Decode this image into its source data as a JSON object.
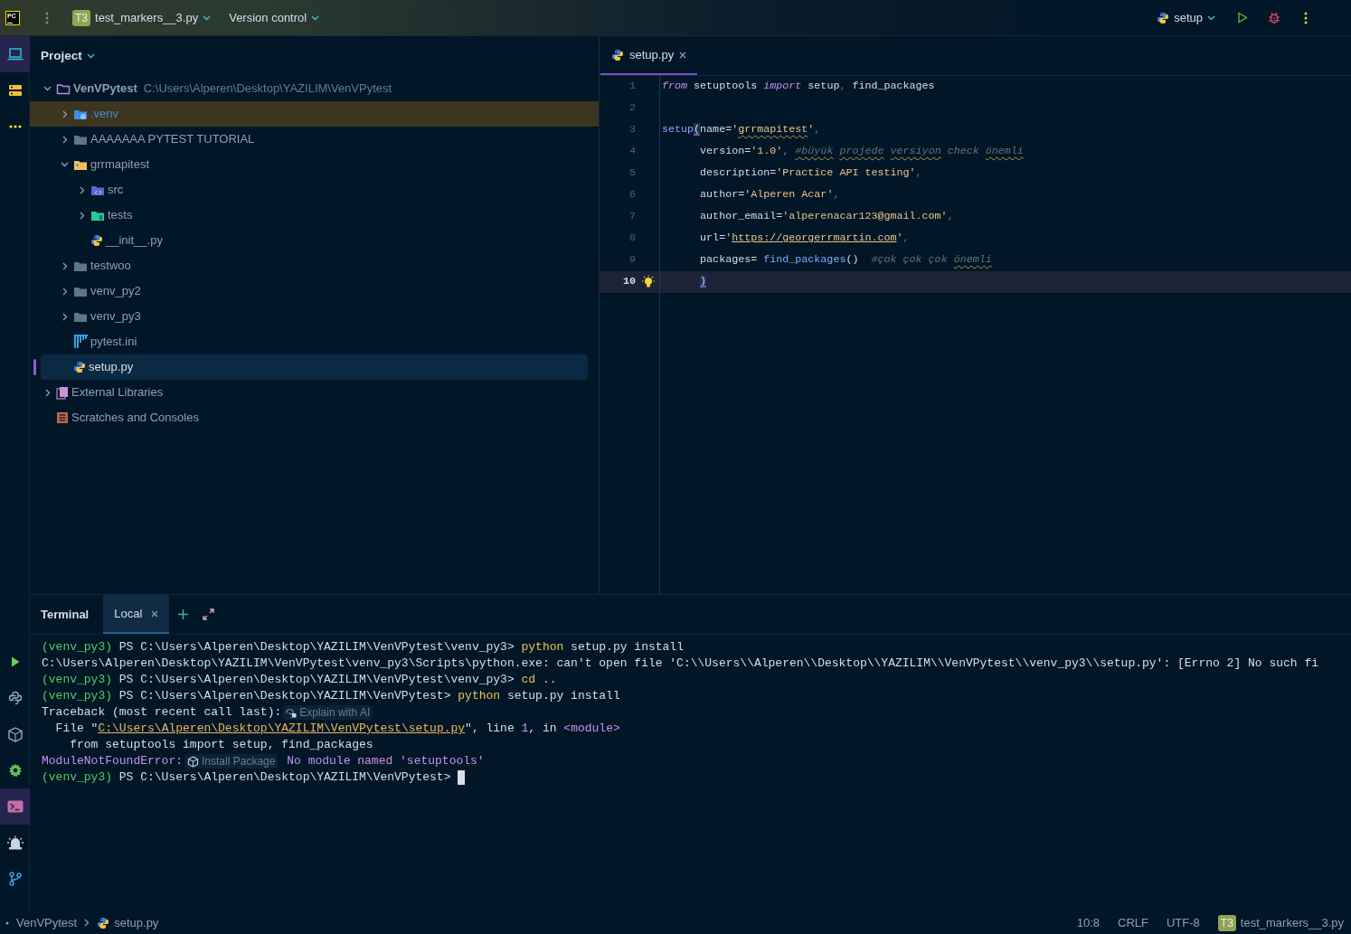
{
  "titlebar": {
    "app_logo": "PC",
    "project_badge": "T3",
    "project": "test_markers__3.py",
    "vcs": "Version control",
    "run_config": "setup"
  },
  "left_toolbar": {
    "top": [
      {
        "kind": "project",
        "selected": true
      },
      {
        "kind": "structure",
        "selected": false
      },
      {
        "kind": "more",
        "selected": false
      }
    ],
    "bottom": [
      {
        "kind": "run",
        "selected": false
      },
      {
        "kind": "python_console",
        "selected": false
      },
      {
        "kind": "python_packages",
        "selected": false
      },
      {
        "kind": "services",
        "selected": false
      },
      {
        "kind": "terminal",
        "selected": true
      },
      {
        "kind": "problems",
        "selected": false
      },
      {
        "kind": "git",
        "selected": false
      }
    ]
  },
  "project": {
    "title": "Project",
    "tree": [
      {
        "name": "VenVPytest",
        "path": "C:\\Users\\Alperen\\Desktop\\YAZILIM\\VenVPytest",
        "kind": "root",
        "expanded": true,
        "selected": false,
        "excluded": false,
        "children": [
          {
            "name": ".venv",
            "kind": "venv",
            "expanded": false,
            "selected": false,
            "excluded": true
          },
          {
            "name": "AAAAAAA PYTEST TUTORIAL",
            "kind": "folder",
            "expanded": false,
            "selected": false,
            "excluded": false
          },
          {
            "name": "grrmapitest",
            "kind": "package",
            "expanded": true,
            "selected": false,
            "excluded": false,
            "children": [
              {
                "name": "src",
                "kind": "source",
                "expanded": false,
                "selected": false,
                "excluded": false
              },
              {
                "name": "tests",
                "kind": "tests",
                "expanded": false,
                "selected": false,
                "excluded": false
              },
              {
                "name": "__init__.py",
                "kind": "python",
                "selected": false,
                "excluded": false
              }
            ]
          },
          {
            "name": "testwoo",
            "kind": "folder",
            "expanded": false,
            "selected": false,
            "excluded": false
          },
          {
            "name": "venv_py2",
            "kind": "folder",
            "expanded": false,
            "selected": false,
            "excluded": false
          },
          {
            "name": "venv_py3",
            "kind": "folder",
            "expanded": false,
            "selected": false,
            "excluded": false
          },
          {
            "name": "pytest.ini",
            "kind": "ini",
            "selected": false,
            "excluded": false
          },
          {
            "name": "setup.py",
            "kind": "python",
            "selected": true,
            "excluded": false
          }
        ]
      },
      {
        "name": "External Libraries",
        "kind": "library",
        "expanded": false,
        "selected": false,
        "excluded": false
      },
      {
        "name": "Scratches and Consoles",
        "kind": "scratches",
        "selected": false,
        "excluded": false
      }
    ]
  },
  "editor": {
    "tabs": [
      {
        "label": "setup.py",
        "selected": true
      }
    ],
    "lines": [
      {
        "number": "1",
        "current": false,
        "segments": [
          {
            "kind": "keyword",
            "text": "from"
          },
          {
            "kind": "plain",
            "text": " setuptools "
          },
          {
            "kind": "keyword",
            "text": "import"
          },
          {
            "kind": "plain",
            "text": " setup"
          },
          {
            "kind": "punct",
            "text": ","
          },
          {
            "kind": "plain",
            "text": " find_packages"
          }
        ]
      },
      {
        "number": "2",
        "current": false
      },
      {
        "number": "3",
        "current": false,
        "segments": [
          {
            "kind": "function",
            "text": "setup"
          },
          {
            "kind": "brace",
            "text": "("
          },
          {
            "kind": "plain",
            "text": "name="
          },
          {
            "kind": "string",
            "text": "'"
          },
          {
            "kind": "string",
            "text": "grrmapitest",
            "typo": true
          },
          {
            "kind": "string",
            "text": "'"
          },
          {
            "kind": "punct",
            "text": ","
          }
        ]
      },
      {
        "number": "4",
        "current": false,
        "segments": [
          {
            "kind": "plain",
            "text": "      version="
          },
          {
            "kind": "string",
            "text": "'1.0'"
          },
          {
            "kind": "punct",
            "text": ", "
          },
          {
            "kind": "comment",
            "text": "#büyük",
            "typo": true
          },
          {
            "kind": "comment",
            "text": " projede",
            "typo": true
          },
          {
            "kind": "comment",
            "text": " versiyon",
            "typo": true
          },
          {
            "kind": "comment",
            "text": " check "
          },
          {
            "kind": "comment",
            "text": "önemli",
            "typo": true
          }
        ]
      },
      {
        "number": "5",
        "current": false,
        "segments": [
          {
            "kind": "plain",
            "text": "      description="
          },
          {
            "kind": "string",
            "text": "'Practice API testing'"
          },
          {
            "kind": "punct",
            "text": ","
          }
        ]
      },
      {
        "number": "6",
        "current": false,
        "segments": [
          {
            "kind": "plain",
            "text": "      author="
          },
          {
            "kind": "string",
            "text": "'Alperen Acar'"
          },
          {
            "kind": "punct",
            "text": ","
          }
        ]
      },
      {
        "number": "7",
        "current": false,
        "segments": [
          {
            "kind": "plain",
            "text": "      author_email="
          },
          {
            "kind": "string",
            "text": "'alperenacar123@gmail.com'"
          },
          {
            "kind": "punct",
            "text": ","
          }
        ]
      },
      {
        "number": "8",
        "current": false,
        "segments": [
          {
            "kind": "plain",
            "text": "      url="
          },
          {
            "kind": "string",
            "text": "'"
          },
          {
            "kind": "url",
            "text": "https://georgerrmartin.com"
          },
          {
            "kind": "string",
            "text": "'"
          },
          {
            "kind": "punct",
            "text": ","
          }
        ]
      },
      {
        "number": "9",
        "current": false,
        "segments": [
          {
            "kind": "plain",
            "text": "      packages= "
          },
          {
            "kind": "function",
            "text": "find_packages"
          },
          {
            "kind": "plain",
            "text": "()"
          },
          {
            "kind": "comment",
            "text": "  #çok çok çok "
          },
          {
            "kind": "comment",
            "text": "önemli",
            "typo": true
          }
        ]
      },
      {
        "number": "10",
        "current": true,
        "intention_bulb": true,
        "segments": [
          {
            "kind": "brace",
            "text": "      )"
          }
        ]
      }
    ]
  },
  "terminal": {
    "title": "Terminal",
    "tabs": [
      {
        "label": "Local",
        "selected": true
      }
    ],
    "lines": [
      [
        {
          "kind": "env",
          "text": "(venv_py3)"
        },
        {
          "kind": "plain",
          "text": " PS C:\\Users\\Alperen\\Desktop\\YAZILIM\\VenVPytest\\venv_py3> "
        },
        {
          "kind": "command",
          "text": "python"
        },
        {
          "kind": "plain",
          "text": " setup.py install"
        }
      ],
      [
        {
          "kind": "plain",
          "text": "C:\\Users\\Alperen\\Desktop\\YAZILIM\\VenVPytest\\venv_py3\\Scripts\\python.exe: can't open file 'C:\\\\Users\\\\Alperen\\\\Desktop\\\\YAZILIM\\\\VenVPytest\\\\venv_py3\\\\setup.py': [Errno 2] No such fi"
        }
      ],
      [
        {
          "kind": "env",
          "text": "(venv_py3)"
        },
        {
          "kind": "plain",
          "text": " PS C:\\Users\\Alperen\\Desktop\\YAZILIM\\VenVPytest\\venv_py3> "
        },
        {
          "kind": "command",
          "text": "cd .."
        }
      ],
      [
        {
          "kind": "env",
          "text": "(venv_py3)"
        },
        {
          "kind": "plain",
          "text": " PS C:\\Users\\Alperen\\Desktop\\YAZILIM\\VenVPytest> "
        },
        {
          "kind": "command",
          "text": "python"
        },
        {
          "kind": "plain",
          "text": " setup.py install"
        }
      ],
      [
        {
          "kind": "plain",
          "text": "Traceback (most recent call last):"
        },
        {
          "kind": "ai_hint",
          "text": "Explain with AI"
        }
      ],
      [
        {
          "kind": "plain",
          "text": "  File \""
        },
        {
          "kind": "link",
          "text": "C:\\Users\\Alperen\\Desktop\\YAZILIM\\VenVPytest\\setup.py"
        },
        {
          "kind": "plain",
          "text": "\", line "
        },
        {
          "kind": "number",
          "text": "1"
        },
        {
          "kind": "plain",
          "text": ", in "
        },
        {
          "kind": "number",
          "text": "<module>"
        }
      ],
      [
        {
          "kind": "plain",
          "text": "    from setuptools import setup, find_packages"
        }
      ],
      [
        {
          "kind": "error",
          "text": "ModuleNotFoundError:"
        },
        {
          "kind": "package_hint",
          "text": "Install Package"
        },
        {
          "kind": "error",
          "text": " No module named 'setuptools'"
        }
      ],
      [
        {
          "kind": "env",
          "text": "(venv_py3)"
        },
        {
          "kind": "plain",
          "text": " PS C:\\Users\\Alperen\\Desktop\\YAZILIM\\VenVPytest> "
        },
        {
          "kind": "cursor"
        }
      ]
    ]
  },
  "status_bar": {
    "breadcrumbs": [
      {
        "kind": "project",
        "label": "VenVPytest"
      },
      {
        "kind": "python",
        "label": "setup.py"
      }
    ],
    "position": "10:8",
    "line_separator": "CRLF",
    "encoding": "UTF-8",
    "project_badge": "T3",
    "project": "test_markers__3.py"
  }
}
